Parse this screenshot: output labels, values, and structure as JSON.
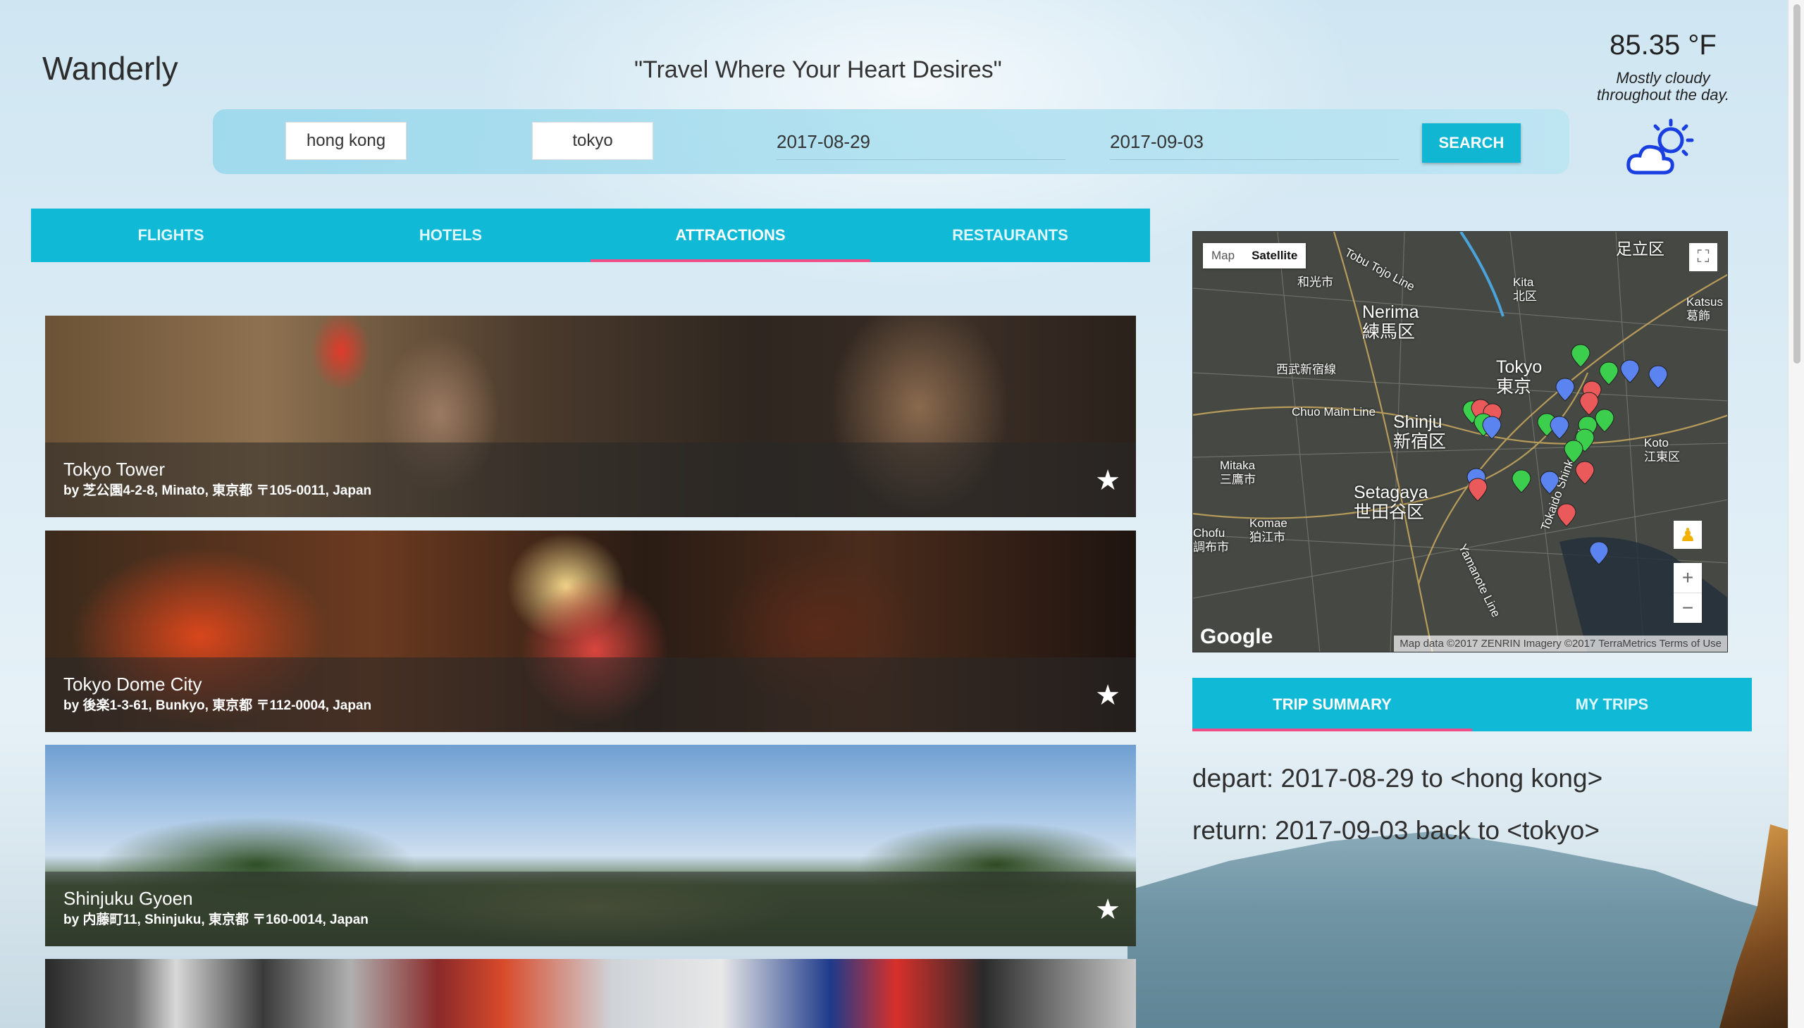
{
  "header": {
    "brand": "Wanderly",
    "tagline": "\"Travel Where Your Heart Desires\""
  },
  "weather": {
    "temperature": "85.35 °F",
    "condition_line1": "Mostly cloudy",
    "condition_line2": "throughout the day.",
    "icon": "partly-cloudy-icon",
    "icon_color": "#1a3fe0"
  },
  "search": {
    "origin": "hong kong",
    "destination": "tokyo",
    "depart_date": "2017-08-29",
    "return_date": "2017-09-03",
    "button_label": "SEARCH"
  },
  "main_tabs": [
    {
      "label": "FLIGHTS",
      "active": false
    },
    {
      "label": "HOTELS",
      "active": false
    },
    {
      "label": "ATTRACTIONS",
      "active": true
    },
    {
      "label": "RESTAURANTS",
      "active": false
    }
  ],
  "attractions": [
    {
      "name": "Tokyo Tower",
      "address": "by 芝公園4-2-8, Minato, 東京都 〒105-0011, Japan"
    },
    {
      "name": "Tokyo Dome City",
      "address": "by 後楽1-3-61, Bunkyo, 東京都 〒112-0004, Japan"
    },
    {
      "name": "Shinjuku Gyoen",
      "address": "by 内藤町11, Shinjuku, 東京都 〒160-0014, Japan"
    }
  ],
  "map": {
    "type_map": "Map",
    "type_satellite": "Satellite",
    "labels": {
      "nerima": "Nerima",
      "nerima_jp": "練馬区",
      "tokyo": "Tokyo",
      "tokyo_jp": "東京",
      "shinjuku": "Shinju",
      "shinjuku_jp": "新宿区",
      "setagaya": "Setagaya",
      "setagaya_jp": "世田谷区",
      "mitaka": "Mitaka",
      "mitaka_jp": "三鷹市",
      "komae": "Komae",
      "komae_jp": "狛江市",
      "chofu": "Chofu",
      "chofu_jp": "調布市",
      "koto": "Koto",
      "koto_jp": "江東区",
      "kita": "Kita",
      "kita_jp": "北区",
      "adachi_jp": "足立区",
      "katsushika": "Katsus",
      "katsushika_jp": "葛飾",
      "chuo_line": "Chuo Main Line",
      "seibu_line": "西武新宿線",
      "tobu_line": "Tobu Tojo Line",
      "wako_jp": "和光市",
      "yamanote": "Yamanote Line",
      "tokaido": "Tokaido Shinkansen"
    },
    "logo": "Google",
    "attribution": "Map data ©2017 ZENRIN Imagery ©2017 TerraMetrics   Terms of Use",
    "zoom_in": "+",
    "zoom_out": "−"
  },
  "summary_tabs": [
    {
      "label": "TRIP SUMMARY",
      "active": true
    },
    {
      "label": "MY TRIPS",
      "active": false
    }
  ],
  "trip": {
    "depart": "depart: 2017-08-29 to <hong kong>",
    "return": "return: 2017-09-03 back to <tokyo>"
  },
  "colors": {
    "accent": "#10b9d6",
    "tab_indicator": "#ef4e86"
  }
}
